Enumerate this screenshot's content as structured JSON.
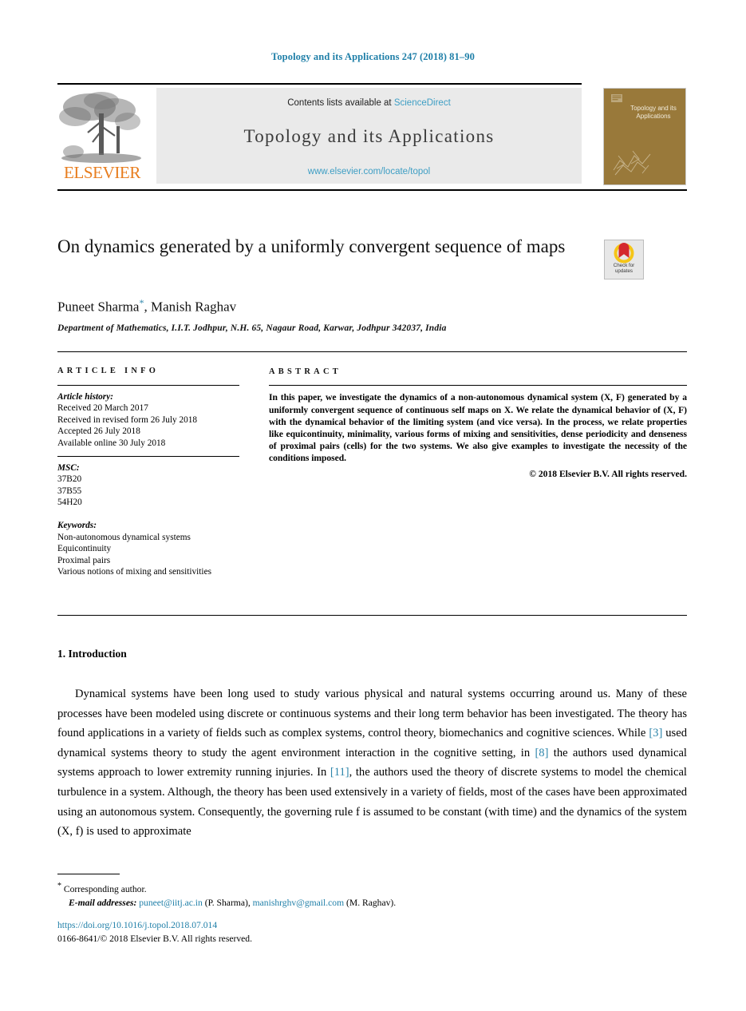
{
  "running_head": "Topology and its Applications 247 (2018) 81–90",
  "masthead": {
    "contents_prefix": "Contents lists available at ",
    "sciencedirect": "ScienceDirect",
    "journal_title": "Topology and its Applications",
    "journal_url": "www.elsevier.com/locate/topol",
    "publisher_wordmark": "ELSEVIER",
    "publisher_logo_icon": "elsevier-tree-logo",
    "cover_title": "Topology and its Applications",
    "cover_color": "#99793a",
    "banner_bg": "#eaeaea"
  },
  "crossmark": {
    "line1": "Check for",
    "line2": "updates",
    "icon": "crossmark-badge-icon",
    "color_ring": "#f5c518",
    "color_mark": "#d4282e"
  },
  "article": {
    "title": "On dynamics generated by a uniformly convergent sequence of maps",
    "authors": "Puneet Sharma",
    "authors_rest": ", Manish Raghav",
    "corresponding_mark": "*",
    "affiliation": "Department of Mathematics, I.I.T. Jodhpur, N.H. 65, Nagaur Road, Karwar, Jodhpur 342037, India"
  },
  "info": {
    "heading": "ARTICLE INFO",
    "history_label": "Article history:",
    "history": [
      "Received 20 March 2017",
      "Received in revised form 26 July 2018",
      "Accepted 26 July 2018",
      "Available online 30 July 2018"
    ],
    "msc_label": "MSC:",
    "msc": [
      "37B20",
      "37B55",
      "54H20"
    ],
    "keywords_label": "Keywords:",
    "keywords": [
      "Non-autonomous dynamical systems",
      "Equicontinuity",
      "Proximal pairs",
      "Various notions of mixing and sensitivities"
    ]
  },
  "abstract": {
    "heading": "ABSTRACT",
    "text": "In this paper, we investigate the dynamics of a non-autonomous dynamical system (X, F) generated by a uniformly convergent sequence of continuous self maps on X. We relate the dynamical behavior of (X, F) with the dynamical behavior of the limiting system (and vice versa). In the process, we relate properties like equicontinuity, minimality, various forms of mixing and sensitivities, dense periodicity and denseness of proximal pairs (cells) for the two systems. We also give examples to investigate the necessity of the conditions imposed.",
    "copyright": "© 2018 Elsevier B.V. All rights reserved."
  },
  "introduction": {
    "heading": "1. Introduction",
    "paragraph_1": "Dynamical systems have been long used to study various physical and natural systems occurring around us. Many of these processes have been modeled using discrete or continuous systems and their long term behavior has been investigated. The theory has found applications in a variety of fields such as complex systems, control theory, biomechanics and cognitive sciences. While ",
    "ref_3": "[3]",
    "paragraph_2": " used dynamical systems theory to study the agent environment interaction in the cognitive setting, in ",
    "ref_8": "[8]",
    "paragraph_3": " the authors used dynamical systems approach to lower extremity running injuries. In ",
    "ref_11": "[11]",
    "paragraph_4": ", the authors used the theory of discrete systems to model the chemical turbulence in a system. Although, the theory has been used extensively in a variety of fields, most of the cases have been approximated using an autonomous system. Consequently, the governing rule f is assumed to be constant (with time) and the dynamics of the system (X, f) is used to approximate"
  },
  "footer": {
    "corresponding_star": "*",
    "corresponding_text": "Corresponding author.",
    "email_label": "E-mail addresses:",
    "email_1": "puneet@iitj.ac.in",
    "email_1_owner": "(P. Sharma),",
    "email_2": "manishrghv@gmail.com",
    "email_2_owner": "(M. Raghav).",
    "doi": "https://doi.org/10.1016/j.topol.2018.07.014",
    "issn_line": "0166-8641/© 2018 Elsevier B.V. All rights reserved."
  },
  "colors": {
    "link": "#1f7fa8",
    "sciencedirect": "#3e9ec4",
    "elsevier_orange": "#e87d1e"
  }
}
